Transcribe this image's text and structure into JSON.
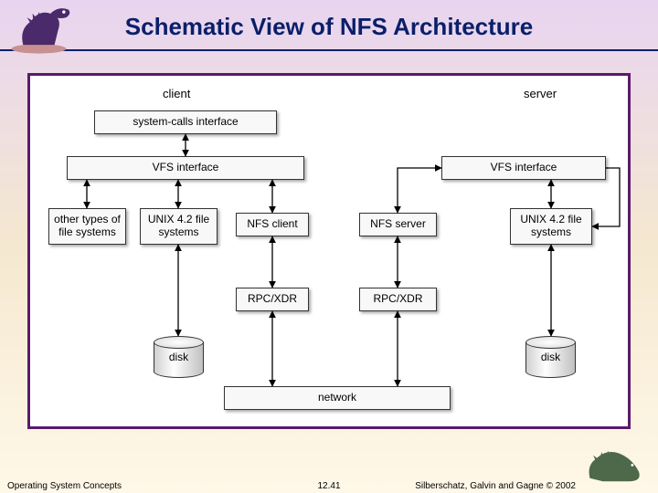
{
  "slide": {
    "title": "Schematic View of NFS Architecture"
  },
  "footer": {
    "left": "Operating System Concepts",
    "center": "12.41",
    "right": "Silberschatz, Galvin and Gagne © 2002"
  },
  "diagram": {
    "labels": {
      "client": "client",
      "server": "server"
    },
    "boxes": {
      "syscalls": "system-calls interface",
      "vfs_client": "VFS interface",
      "vfs_server": "VFS interface",
      "other_fs": "other types of file systems",
      "unix_fs_client": "UNIX 4.2 file systems",
      "nfs_client": "NFS client",
      "nfs_server": "NFS server",
      "unix_fs_server": "UNIX 4.2 file systems",
      "rpc_client": "RPC/XDR",
      "rpc_server": "RPC/XDR",
      "network": "network"
    },
    "cylinders": {
      "disk_client": "disk",
      "disk_server": "disk"
    }
  }
}
